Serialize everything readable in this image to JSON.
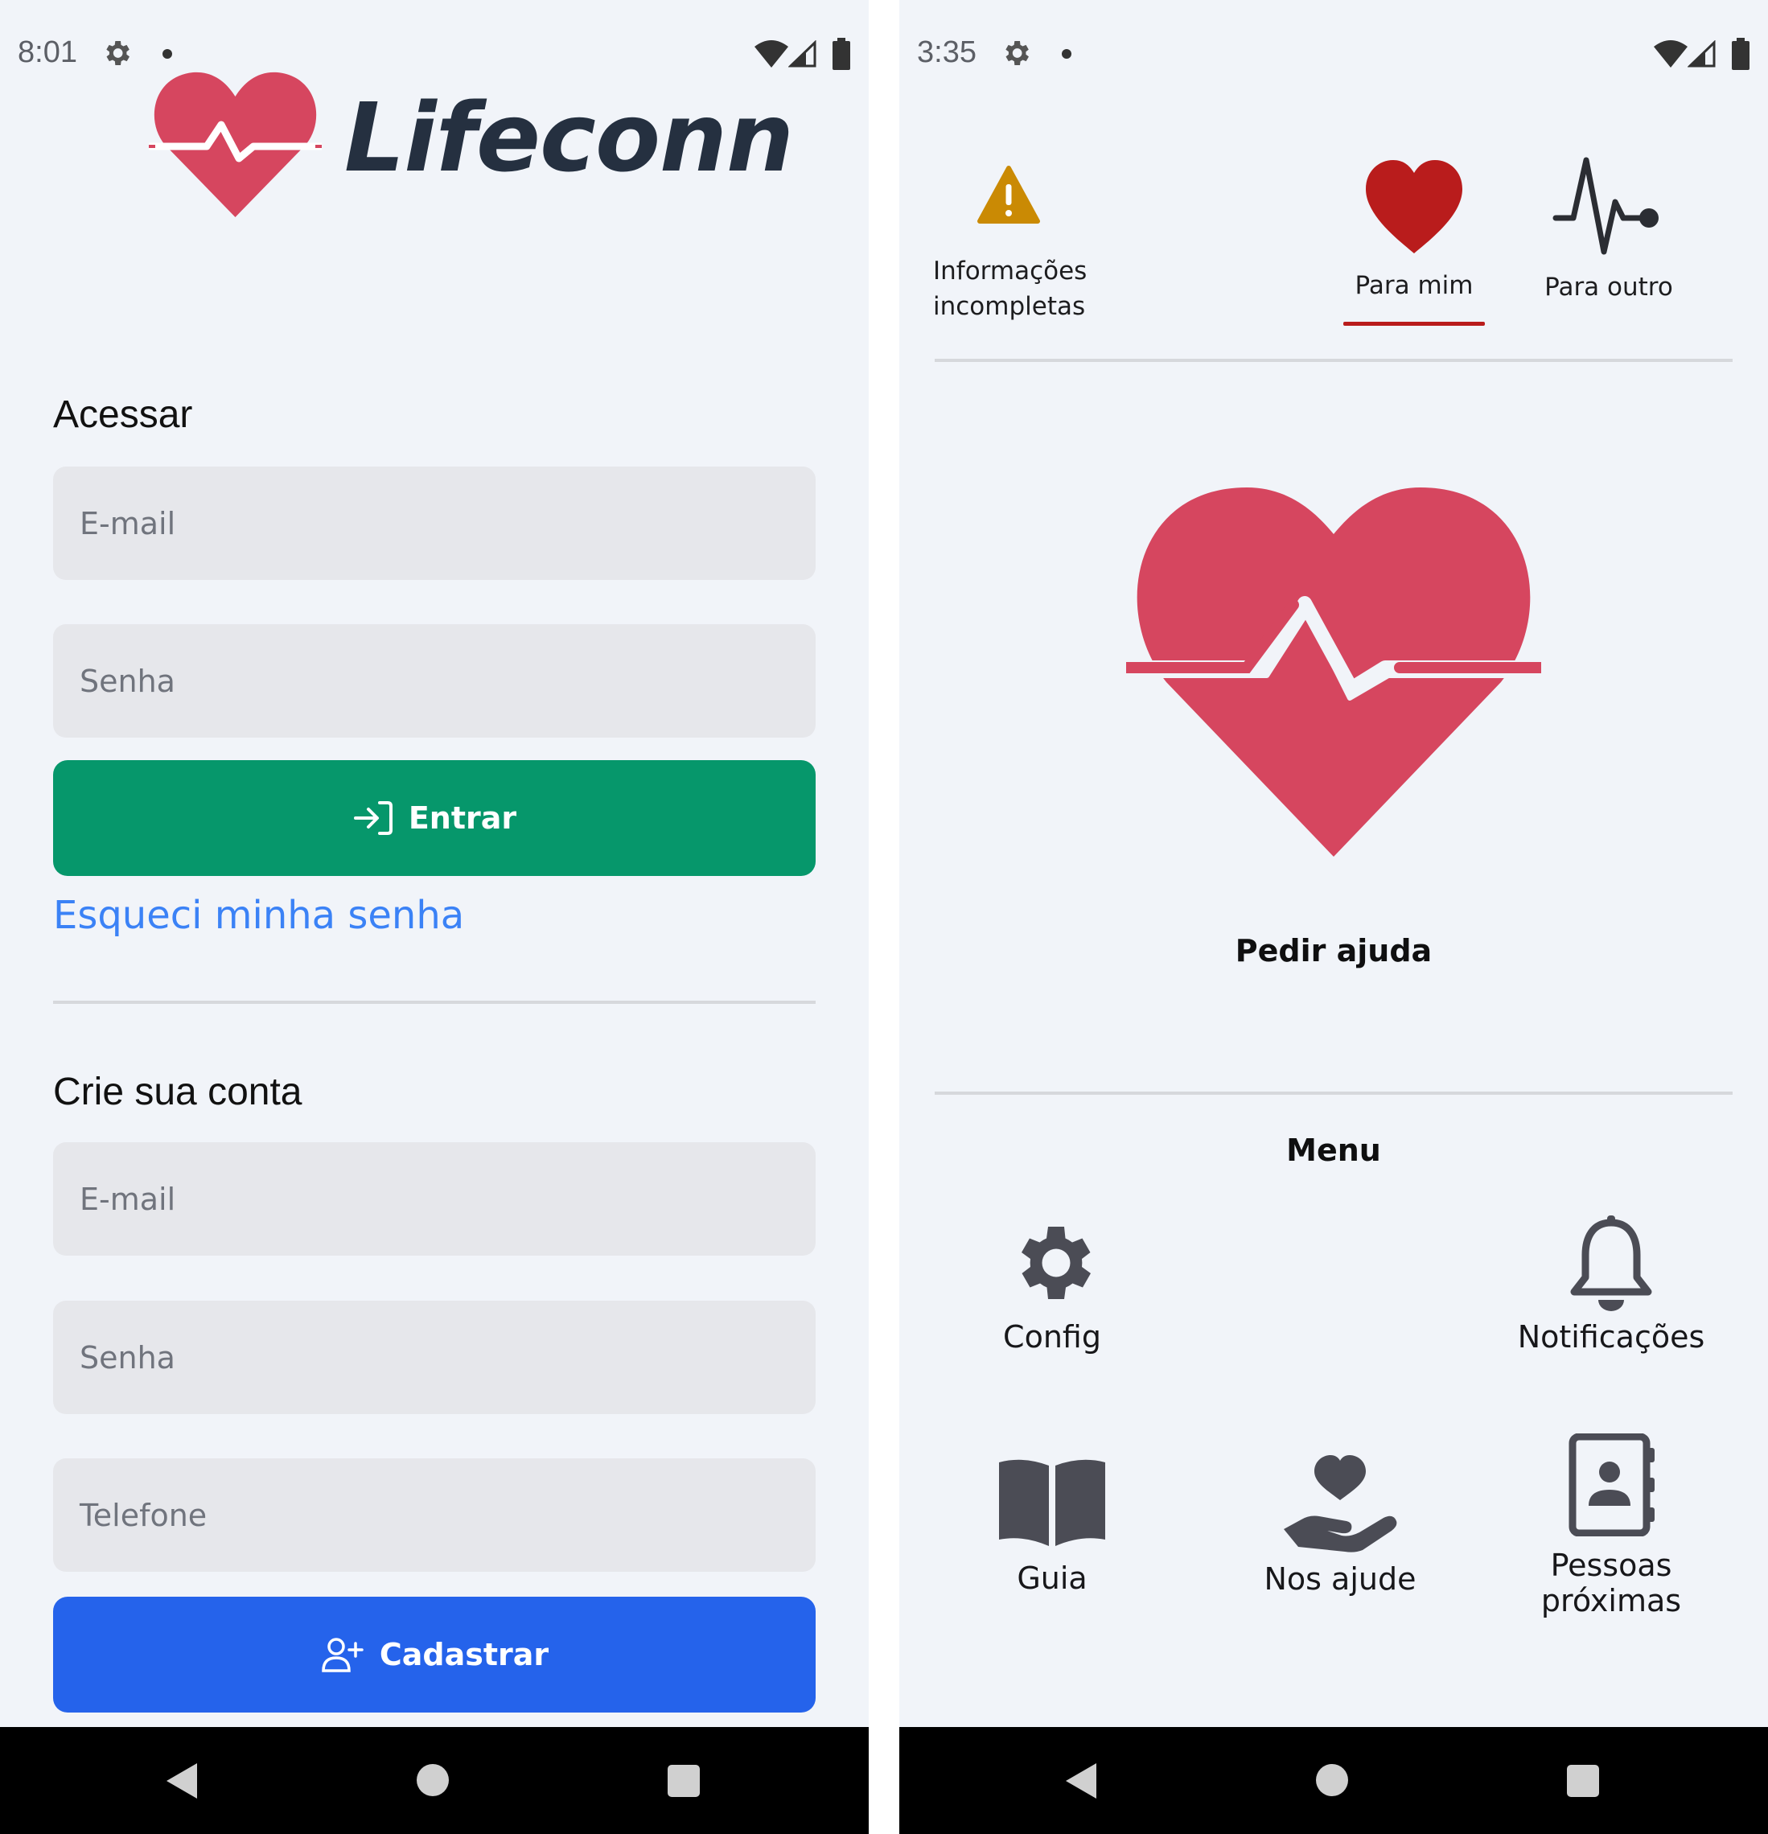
{
  "colors": {
    "brand_red": "#d6465f",
    "primary_green": "#06976b",
    "primary_blue": "#2563eb",
    "link_blue": "#3b82f6",
    "warning_amber": "#ca8a04",
    "active_red": "#b91c1c",
    "icon_gray": "#4b4c55",
    "background": "#f1f4f9"
  },
  "left_screen": {
    "status_bar": {
      "time": "8:01",
      "icons": [
        "gear-icon",
        "dot-icon",
        "wifi-icon",
        "signal-icon",
        "battery-icon"
      ]
    },
    "logo": {
      "text": "Lifeconn",
      "icon": "heart-pulse-icon"
    },
    "login": {
      "title": "Acessar",
      "email_placeholder": "E-mail",
      "password_placeholder": "Senha",
      "submit_label": "Entrar",
      "submit_icon": "login-icon",
      "forgot_label": "Esqueci minha senha"
    },
    "signup": {
      "title": "Crie sua conta",
      "email_placeholder": "E-mail",
      "password_placeholder": "Senha",
      "phone_placeholder": "Telefone",
      "submit_label": "Cadastrar",
      "submit_icon": "user-plus-icon"
    }
  },
  "right_screen": {
    "status_bar": {
      "time": "3:35",
      "icons": [
        "gear-icon",
        "dot-icon",
        "wifi-icon",
        "signal-icon",
        "battery-icon"
      ]
    },
    "top_tabs": [
      {
        "label": "Informações incompletas",
        "icon": "warning-icon",
        "active": false
      },
      {
        "label": "Para mim",
        "icon": "heart-icon",
        "active": true
      },
      {
        "label": "Para outro",
        "icon": "pulse-icon",
        "active": false
      }
    ],
    "help_label": "Pedir ajuda",
    "menu": {
      "title": "Menu",
      "items": [
        {
          "label": "Config",
          "icon": "gear-icon"
        },
        {
          "label": "Notificações",
          "icon": "bell-icon"
        },
        {
          "label": "Guia",
          "icon": "book-icon"
        },
        {
          "label": "Nos ajude",
          "icon": "hand-heart-icon"
        },
        {
          "label": "Pessoas próximas",
          "icon": "contacts-icon"
        }
      ]
    }
  }
}
